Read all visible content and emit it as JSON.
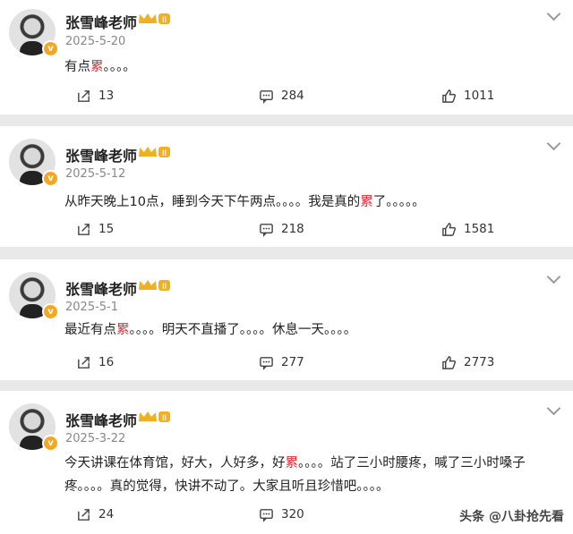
{
  "posts": [
    {
      "author": "张雪峰老师",
      "date": "2025-5-20",
      "text_parts": [
        "有点",
        "累",
        "。。。。"
      ],
      "repost": "13",
      "comment": "284",
      "like": "1011"
    },
    {
      "author": "张雪峰老师",
      "date": "2025-5-12",
      "text_parts": [
        "从昨天晚上10点，睡到今天下午两点。。。。我是真的",
        "累",
        "了。。。。。"
      ],
      "repost": "15",
      "comment": "218",
      "like": "1581"
    },
    {
      "author": "张雪峰老师",
      "date": "2025-5-1",
      "text_parts": [
        "最近有点",
        "累",
        "。。。。明天不直播了。。。。休息一天。。。。"
      ],
      "repost": "16",
      "comment": "277",
      "like": "2773"
    },
    {
      "author": "张雪峰老师",
      "date": "2025-3-22",
      "text_parts": [
        "今天讲课在体育馆，好大，人好多，好",
        "累",
        "。。。。站了三小时腰疼，喊了三小时嗓子疼。。。。真的觉得，快讲不动了。大家且听且珍惜吧。。。。"
      ],
      "repost": "24",
      "comment": "320",
      "like": ""
    }
  ],
  "watermark": "头条 @八卦抢先看",
  "colors": {
    "highlight": "#e0303c",
    "verify_badge": "#f5a623",
    "crown": "#f0b020"
  },
  "icons": [
    "avatar",
    "verified-badge",
    "crown-icon",
    "chevron-down-icon",
    "repost-icon",
    "comment-icon",
    "like-icon"
  ]
}
